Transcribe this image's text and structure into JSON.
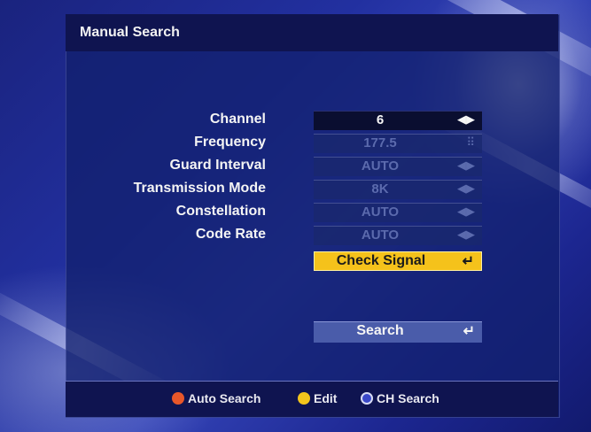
{
  "screen": {
    "title": "Manual Search"
  },
  "form": {
    "rows": [
      {
        "label": "Channel",
        "value": "6",
        "icon": "left-right-arrows-icon",
        "active": true
      },
      {
        "label": "Frequency",
        "value": "177.5",
        "icon": "numeric-keypad-icon",
        "active": false
      },
      {
        "label": "Guard Interval",
        "value": "AUTO",
        "icon": "left-right-arrows-icon",
        "active": false
      },
      {
        "label": "Transmission Mode",
        "value": "8K",
        "icon": "left-right-arrows-icon",
        "active": false
      },
      {
        "label": "Constellation",
        "value": "AUTO",
        "icon": "left-right-arrows-icon",
        "active": false
      },
      {
        "label": "Code Rate",
        "value": "AUTO",
        "icon": "left-right-arrows-icon",
        "active": false
      }
    ]
  },
  "buttons": {
    "check_signal": "Check Signal",
    "search": "Search",
    "enter_glyph": "↵"
  },
  "legend": {
    "auto_search": "Auto Search",
    "edit": "Edit",
    "ch_search": "CH Search"
  },
  "colors": {
    "auto_search_dot": "#e8572a",
    "edit_dot": "#f3c51c",
    "ch_search_dot": "#3a48c8",
    "highlight": "#f5c21b"
  }
}
